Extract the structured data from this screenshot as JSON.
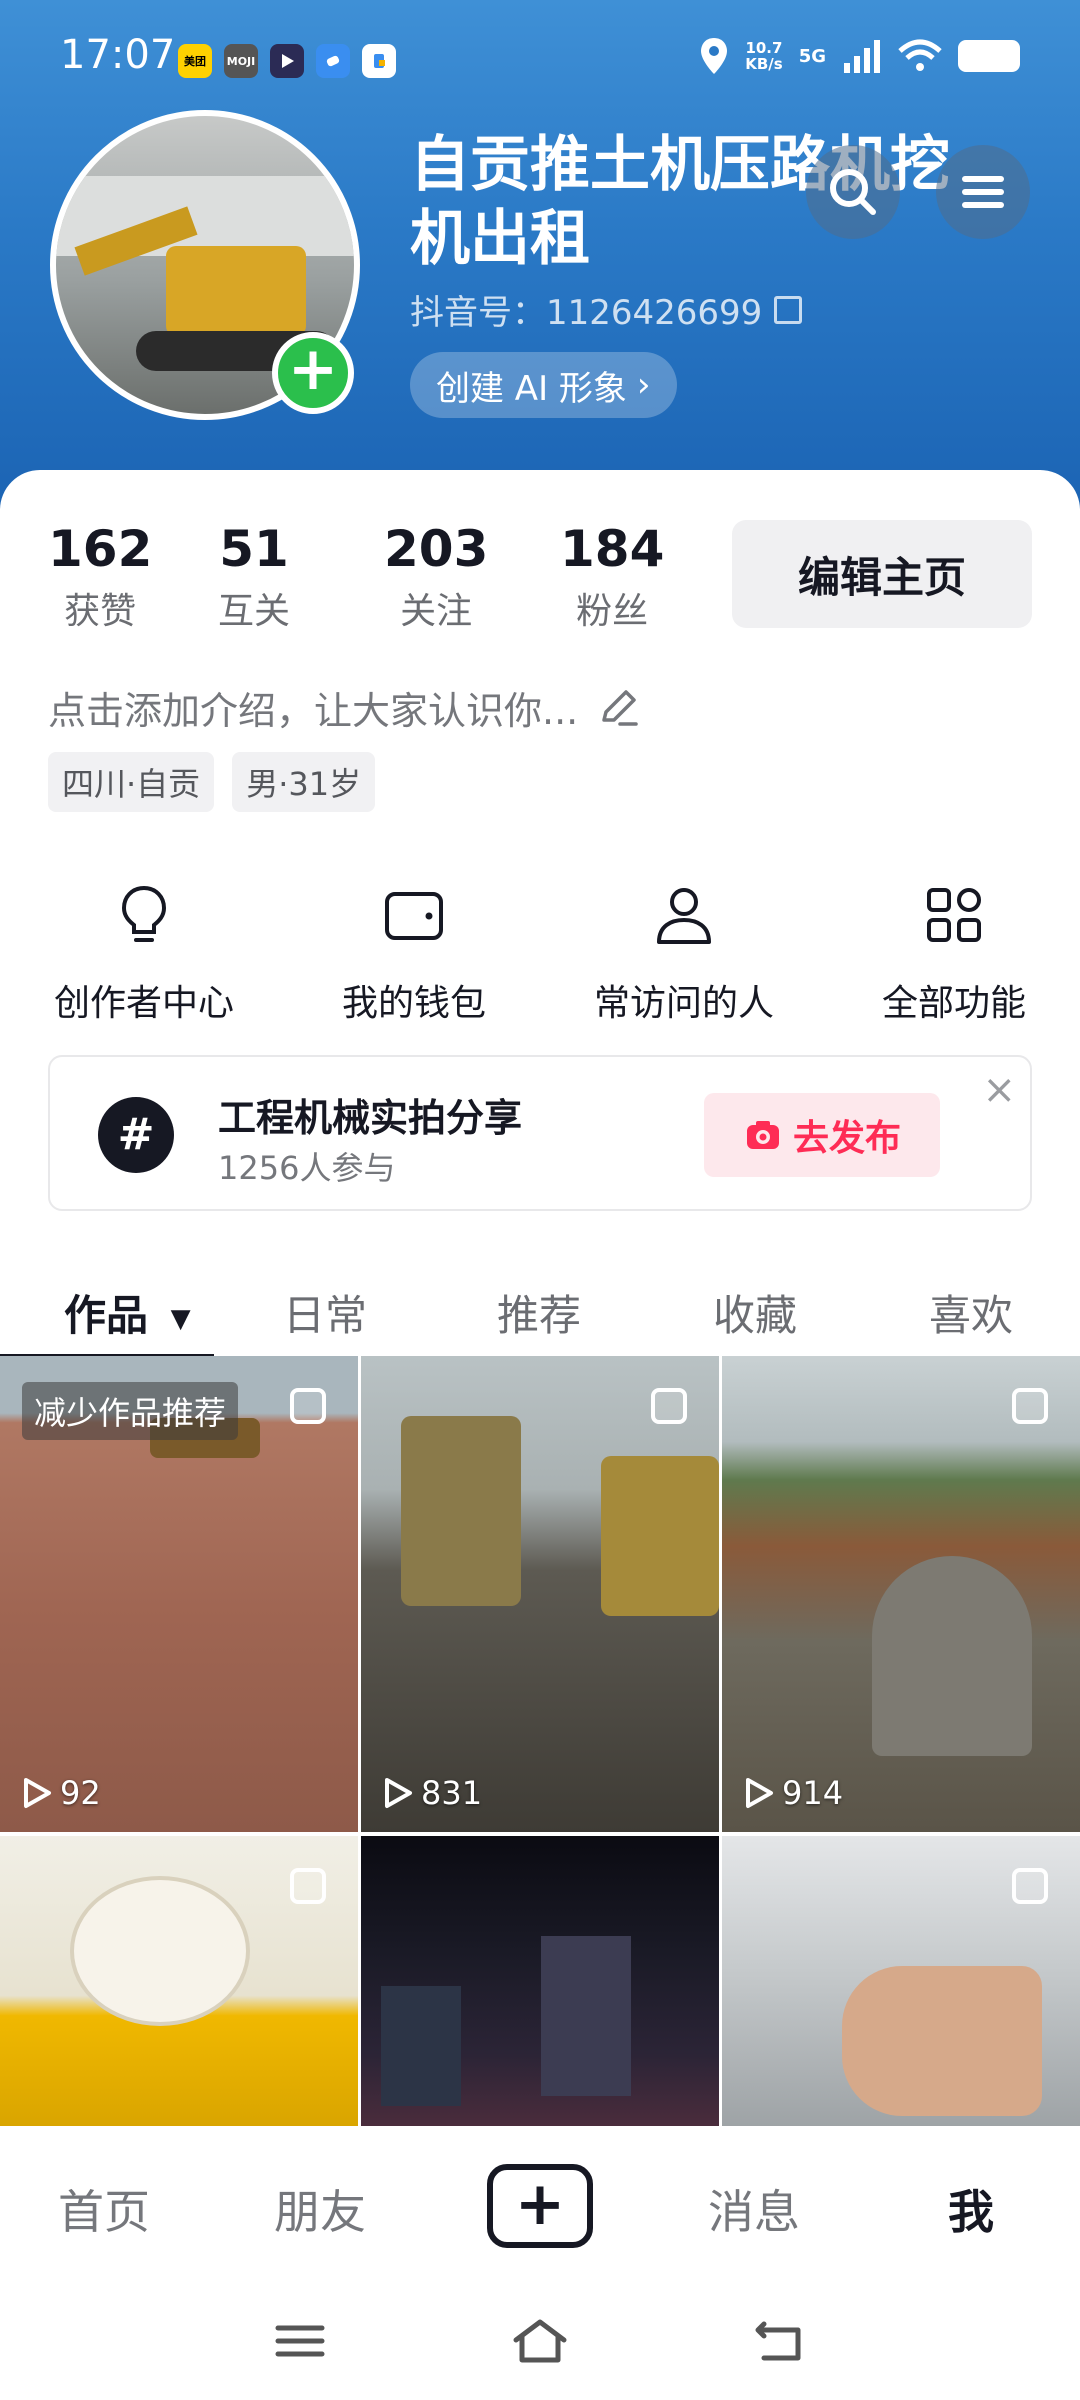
{
  "status_bar": {
    "time": "17:07",
    "apps": [
      "美团",
      "MOJI",
      "",
      "",
      ""
    ],
    "net_speed_value": "10.7",
    "net_speed_unit": "KB/s",
    "network": "5G"
  },
  "profile": {
    "username": "自贡推土机压路机挖机出租",
    "douyin_id": "抖音号：1126426699",
    "ai_button": "创建 AI 形象",
    "ai_button_chevron": "›"
  },
  "stats": [
    {
      "value": "162",
      "label": "获赞"
    },
    {
      "value": "51",
      "label": "互关"
    },
    {
      "value": "203",
      "label": "关注"
    },
    {
      "value": "184",
      "label": "粉丝"
    }
  ],
  "edit_button": "编辑主页",
  "bio": {
    "text": "点击添加介绍，让大家认识你...",
    "tags": [
      "四川·自贡",
      "男·31岁"
    ]
  },
  "shortcuts": [
    {
      "label": "创作者中心",
      "icon": "lightbulb-icon"
    },
    {
      "label": "我的钱包",
      "icon": "wallet-icon"
    },
    {
      "label": "常访问的人",
      "icon": "person-icon"
    },
    {
      "label": "全部功能",
      "icon": "grid-icon"
    }
  ],
  "topic": {
    "hash": "#",
    "title": "工程机械实拍分享",
    "participants": "1256人参与",
    "publish_button": "去发布",
    "close": "×"
  },
  "tabs": [
    {
      "label": "作品",
      "active": true
    },
    {
      "label": "日常",
      "active": false
    },
    {
      "label": "推荐",
      "active": false
    },
    {
      "label": "收藏",
      "active": false
    },
    {
      "label": "喜欢",
      "active": false
    }
  ],
  "tab_dropdown_arrow": "▼",
  "works": {
    "reduce_label": "减少作品推荐",
    "items": [
      {
        "plays": "92"
      },
      {
        "plays": "831"
      },
      {
        "plays": "914"
      },
      {
        "plays": ""
      },
      {
        "plays": ""
      },
      {
        "plays": ""
      }
    ]
  },
  "bottom_nav": {
    "home": "首页",
    "friends": "朋友",
    "plus": "+",
    "messages": "消息",
    "me": "我"
  },
  "colors": {
    "header_blue": "#2a79c6",
    "accent_red": "#fe2c55",
    "add_green": "#2bbf4c"
  }
}
